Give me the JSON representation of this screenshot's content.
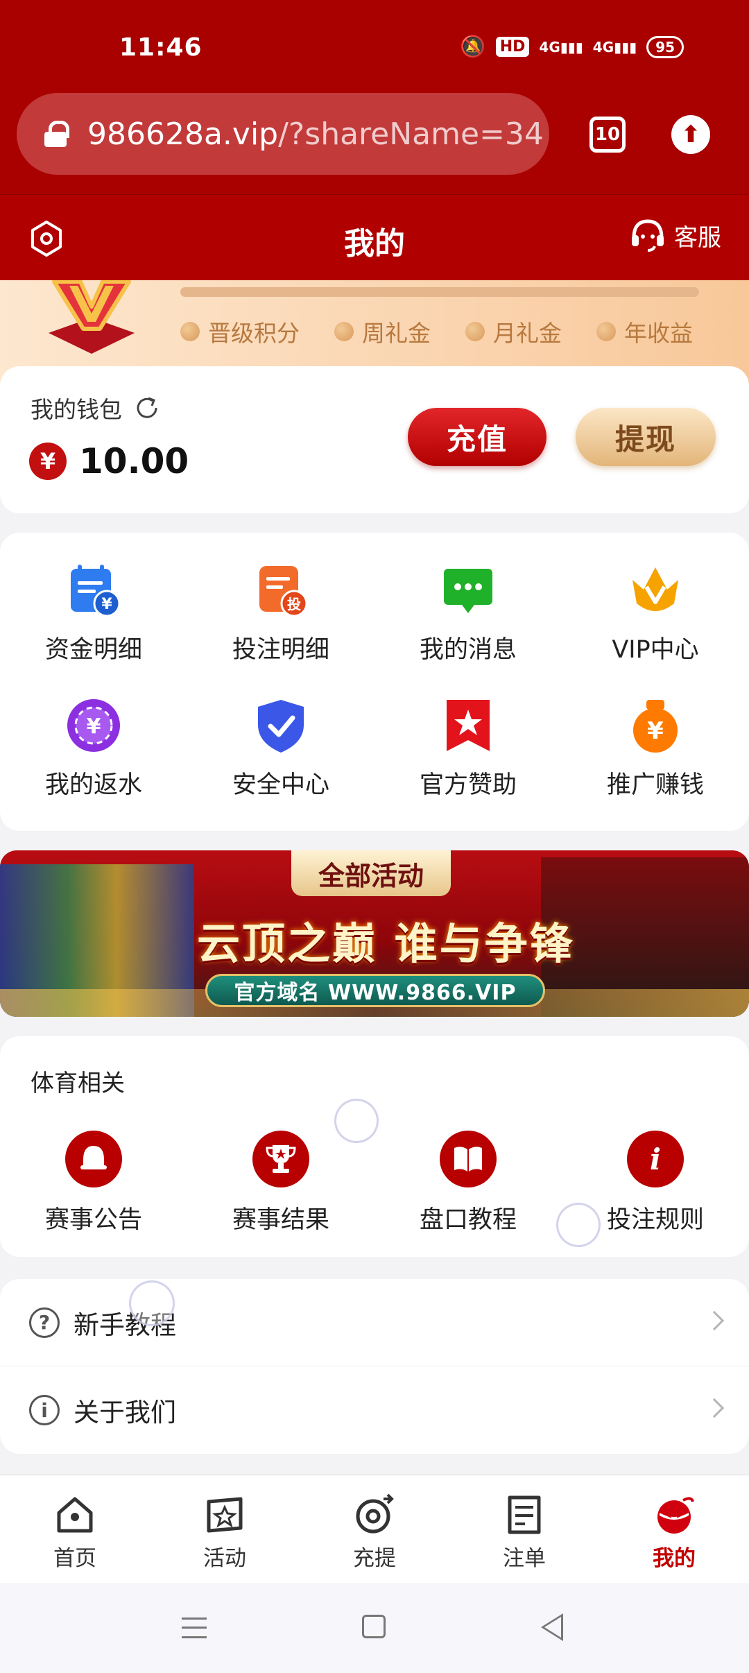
{
  "status": {
    "time": "11:46",
    "hd": "HD",
    "net1": "4G",
    "net2": "4G",
    "battery": "95"
  },
  "browser": {
    "url_domain": "986628a.vip",
    "url_rest": "/?shareName=34",
    "tab_count": "10"
  },
  "header": {
    "title": "我的",
    "service_label": "客服"
  },
  "vip": {
    "tags": [
      "晋级积分",
      "周礼金",
      "月礼金",
      "年收益"
    ]
  },
  "wallet": {
    "label": "我的钱包",
    "currency_symbol": "¥",
    "amount": "10.00",
    "recharge_label": "充值",
    "withdraw_label": "提现"
  },
  "grid": [
    {
      "label": "资金明细",
      "icon": "fund-details-icon",
      "color": "#2f7bf0"
    },
    {
      "label": "投注明细",
      "icon": "bet-details-icon",
      "color": "#f36b2a"
    },
    {
      "label": "我的消息",
      "icon": "message-icon",
      "color": "#1fb12a"
    },
    {
      "label": "VIP中心",
      "icon": "vip-icon",
      "color": "#f6a300"
    },
    {
      "label": "我的返水",
      "icon": "rebate-icon",
      "color": "#8b2fe0"
    },
    {
      "label": "安全中心",
      "icon": "shield-icon",
      "color": "#3a57e8"
    },
    {
      "label": "官方赞助",
      "icon": "sponsor-icon",
      "color": "#e3131b"
    },
    {
      "label": "推广赚钱",
      "icon": "promote-icon",
      "color": "#ff7a00"
    }
  ],
  "banner": {
    "tag": "全部活动",
    "headline": "云顶之巅 谁与争锋",
    "domain": "官方域名 WWW.9866.VIP"
  },
  "sports": {
    "title": "体育相关",
    "items": [
      {
        "label": "赛事公告",
        "icon": "bell-icon"
      },
      {
        "label": "赛事结果",
        "icon": "trophy-icon"
      },
      {
        "label": "盘口教程",
        "icon": "book-icon"
      },
      {
        "label": "投注规则",
        "icon": "info-icon"
      }
    ]
  },
  "menu": [
    {
      "label": "新手教程",
      "icon": "question-icon",
      "glyph": "?"
    },
    {
      "label": "关于我们",
      "icon": "info-circle-icon",
      "glyph": "i"
    }
  ],
  "nav": [
    {
      "label": "首页",
      "icon": "home-icon"
    },
    {
      "label": "活动",
      "icon": "activity-icon"
    },
    {
      "label": "充提",
      "icon": "recharge-icon"
    },
    {
      "label": "注单",
      "icon": "orders-icon"
    },
    {
      "label": "我的",
      "icon": "profile-icon",
      "active": true
    }
  ]
}
